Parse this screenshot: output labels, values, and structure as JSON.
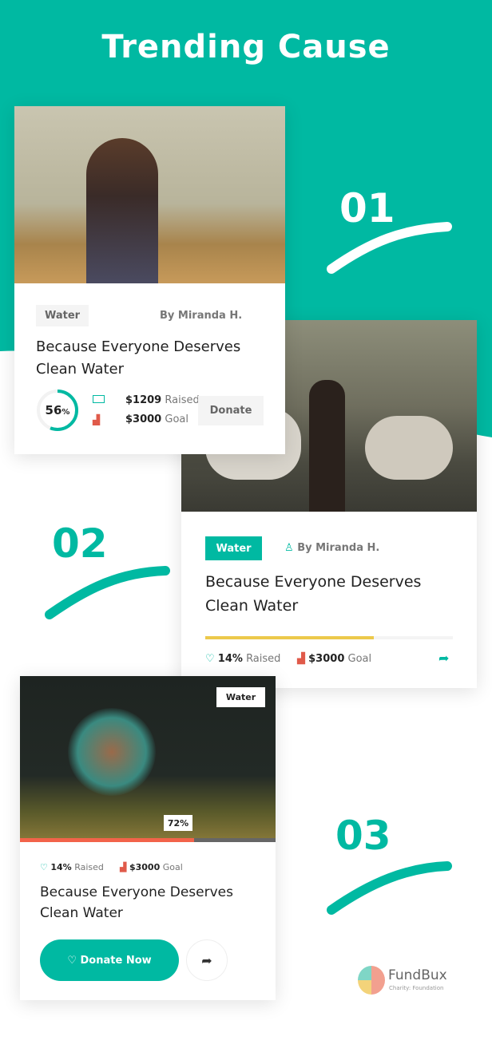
{
  "header": {
    "title": "Trending Cause"
  },
  "colors": {
    "accent": "#00b9a2",
    "yellow": "#ecc94b",
    "red": "#f2634a"
  },
  "steps": [
    "01",
    "02",
    "03"
  ],
  "card1": {
    "tag": "Water",
    "author": "By Miranda H.",
    "title_line1": "Because Everyone Deserves",
    "title_line2": "Clean Water",
    "progress_percent": 56,
    "progress_num": "56",
    "progress_unit": "%",
    "raised_amount": "$1209",
    "raised_label": "Raised",
    "goal_amount": "$3000",
    "goal_label": "Goal",
    "donate_label": "Donate"
  },
  "card2": {
    "tag": "Water",
    "author": "By Miranda H.",
    "title_line1": "Because Everyone Deserves",
    "title_line2": "Clean Water",
    "progress_percent": 68,
    "raised_amount": "14%",
    "raised_label": "Raised",
    "goal_amount": "$3000",
    "goal_label": "Goal"
  },
  "card3": {
    "tag": "Water",
    "progress_label": "72%",
    "progress_percent": 68,
    "raised_amount": "14%",
    "raised_label": "Raised",
    "goal_amount": "$3000",
    "goal_label": "Goal",
    "title_line1": "Because Everyone Deserves",
    "title_line2": "Clean Water",
    "donate_label": "Donate Now"
  },
  "logo": {
    "name": "FundBux",
    "tagline": "Charity: Foundation"
  }
}
